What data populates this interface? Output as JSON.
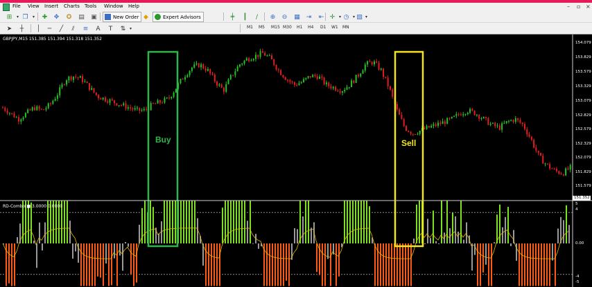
{
  "menu": {
    "items": [
      "File",
      "View",
      "Insert",
      "Charts",
      "Tools",
      "Window",
      "Help"
    ]
  },
  "toolbar": {
    "new_order_label": "New Order",
    "expert_advisors_label": "Expert Advisors",
    "timeframes": [
      "M1",
      "M5",
      "M15",
      "M30",
      "H1",
      "H4",
      "D1",
      "W1",
      "MN"
    ]
  },
  "chart": {
    "info_line": "GBPJPY,M15  151.385 151.394 151.318 151.352",
    "indicator_line": "RD-Combo(■  3.0000 0.0000",
    "price_labels": [
      "154.079",
      "153.829",
      "153.579",
      "153.329",
      "153.079",
      "152.829",
      "152.579",
      "152.329",
      "152.079",
      "151.829",
      "151.579"
    ],
    "current_price": "151.352",
    "indicator_labels": [
      "5",
      "4",
      "0.00",
      "-4",
      "-5"
    ],
    "buy_label": "Buy",
    "sell_label": "Sell",
    "colors": {
      "bull": "#22c322",
      "bear": "#e31e1e",
      "buy_box": "#2fb64a",
      "sell_box": "#f3e71c",
      "hist_neutral": "#9a9a9a",
      "hist_high": "#7fe21c",
      "hist_low": "#ff5a14",
      "signal_line": "#e6b800"
    }
  },
  "chart_data": {
    "type": "candlestick",
    "symbol": "GBPJPY",
    "timeframe": "M15",
    "ohlc_last": {
      "open": 151.385,
      "high": 151.394,
      "low": 151.318,
      "close": 151.352
    },
    "price_axis_ticks": [
      154.079,
      153.829,
      153.579,
      153.329,
      153.079,
      152.829,
      152.579,
      152.329,
      152.079,
      151.829,
      151.579
    ],
    "close_path": [
      153.05,
      152.95,
      152.85,
      152.95,
      153.05,
      153.0,
      153.1,
      153.3,
      153.55,
      153.6,
      153.55,
      153.4,
      153.25,
      153.2,
      153.15,
      153.1,
      153.05,
      153.0,
      153.0,
      153.1,
      153.15,
      153.2,
      153.4,
      153.6,
      153.75,
      153.8,
      153.7,
      153.5,
      153.35,
      153.6,
      153.8,
      153.9,
      153.95,
      154.0,
      153.9,
      153.7,
      153.55,
      153.45,
      153.5,
      153.6,
      153.6,
      153.45,
      153.4,
      153.35,
      153.45,
      153.6,
      153.8,
      153.85,
      153.7,
      153.4,
      153.0,
      152.7,
      152.6,
      152.65,
      152.7,
      152.75,
      152.8,
      152.85,
      152.95,
      153.0,
      152.95,
      152.85,
      152.75,
      152.7,
      152.8,
      152.85,
      152.75,
      152.5,
      152.2,
      152.05,
      151.95,
      151.9,
      152.0
    ],
    "indicator": {
      "name": "RD-Combo",
      "values_shown": [
        3.0,
        0.0
      ],
      "axis_ticks": [
        5,
        4,
        0,
        -4,
        -5
      ]
    },
    "annotations": [
      {
        "label": "Buy",
        "color": "green"
      },
      {
        "label": "Sell",
        "color": "yellow"
      }
    ]
  }
}
